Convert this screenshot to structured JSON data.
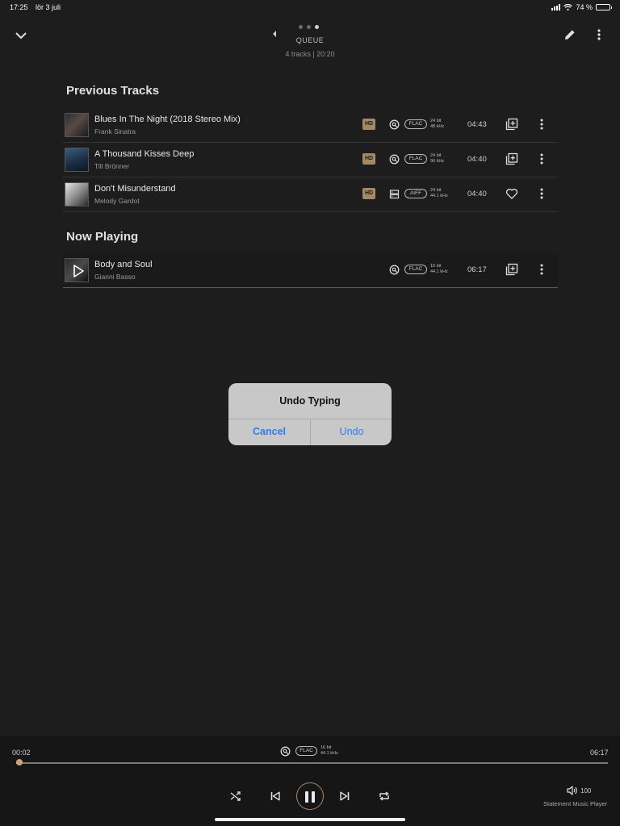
{
  "status_bar": {
    "time": "17:25",
    "date": "lör 3 juli",
    "battery": "74 %",
    "battery_level": 0.74
  },
  "header": {
    "title": "QUEUE",
    "subtitle": "4 tracks | 20:20",
    "page_count": 3,
    "active_page": 3
  },
  "previous": {
    "title": "Previous Tracks",
    "tracks": [
      {
        "title": "Blues In The Night (2018 Stereo Mix)",
        "artist": "Frank Sinatra",
        "badge": "HD",
        "source_icon": "search-source-icon",
        "format": "FLAC",
        "bit_depth": "24 bit",
        "sample_rate": "48 kHz",
        "duration": "04:43",
        "action_icon": "add-to-playlist-icon"
      },
      {
        "title": "A Thousand Kisses Deep",
        "artist": "Till Brönner",
        "badge": "HD",
        "source_icon": "search-source-icon",
        "format": "FLAC",
        "bit_depth": "24 bit",
        "sample_rate": "96 kHz",
        "duration": "04:40",
        "action_icon": "add-to-playlist-icon"
      },
      {
        "title": "Don't Misunderstand",
        "artist": "Melody Gardot",
        "badge": "HD",
        "source_icon": "server-icon",
        "format": "AIFF",
        "bit_depth": "24 bit",
        "sample_rate": "44.1 kHz",
        "duration": "04:40",
        "action_icon": "heart-icon"
      }
    ]
  },
  "now_playing": {
    "title": "Now Playing",
    "track": {
      "title": "Body and Soul",
      "artist": "Gianni Basso",
      "source_icon": "search-source-icon",
      "format": "FLAC",
      "bit_depth": "16 bit",
      "sample_rate": "44.1 kHz",
      "duration": "06:17",
      "action_icon": "add-to-playlist-icon"
    }
  },
  "dialog": {
    "title": "Undo Typing",
    "cancel_label": "Cancel",
    "confirm_label": "Undo"
  },
  "player": {
    "elapsed": "00:02",
    "remaining": "06:17",
    "format": "FLAC",
    "bit_depth": "16 bit",
    "sample_rate": "44.1 kHz",
    "progress": 0.005,
    "volume": "100",
    "device": "Statement Music Player"
  },
  "colors": {
    "background": "#1d1d1d",
    "accent": "#c8a37a",
    "hd_badge": "#a58866",
    "dialog_button": "#2f7bf5"
  }
}
